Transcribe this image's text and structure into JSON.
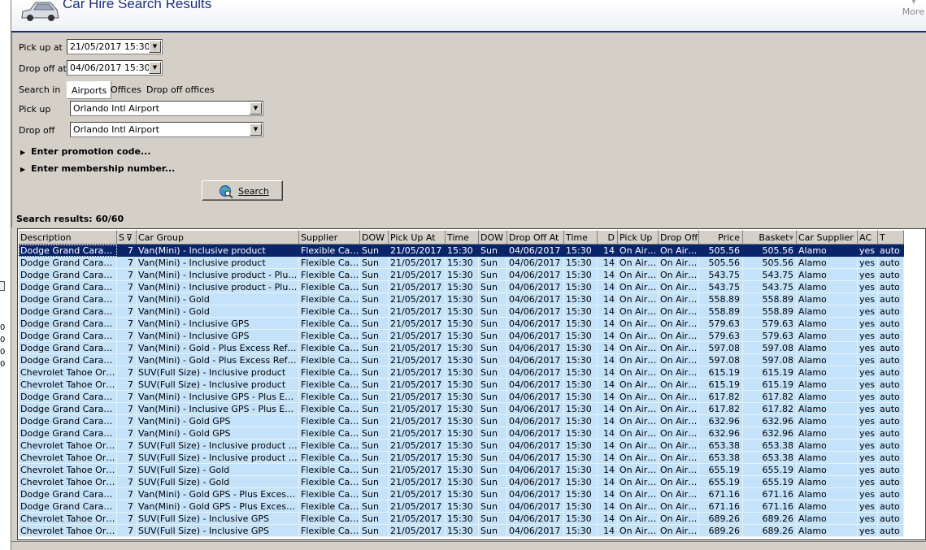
{
  "header": {
    "title": "Car Hire Search Results",
    "more_label": "More"
  },
  "left_strip": {
    "labels": [
      "0",
      "0",
      "0",
      "0"
    ]
  },
  "form": {
    "pickup_at_label": "Pick up at",
    "pickup_at_value": "21/05/2017 15:30",
    "dropoff_at_label": "Drop off at",
    "dropoff_at_value": "04/06/2017 15:30",
    "search_in_label": "Search in",
    "search_in_options": [
      "Airports",
      "Offices",
      "Drop off offices"
    ],
    "search_in_selected": "Airports",
    "pickup_label": "Pick up",
    "pickup_value": "Orlando Intl Airport",
    "dropoff_label": "Drop off",
    "dropoff_value": "Orlando Intl Airport",
    "promo_label": "Enter promotion code...",
    "membership_label": "Enter membership number...",
    "search_button": "Search",
    "results_label": "Search results: 60/60"
  },
  "grid": {
    "columns": [
      "Description",
      "S",
      "Car Group",
      "Supplier",
      "DOW",
      "Pick Up At",
      "Time",
      "DOW",
      "Drop Off At",
      "Time",
      "D",
      "Pick Up",
      "Drop Off",
      "Price",
      "Basket",
      "Car Supplier",
      "AC",
      "T"
    ],
    "rows": [
      [
        "Dodge Grand Caravan Or Similar",
        "7",
        "Van(Mini) - Inclusive product",
        "Flexible Car Hire",
        "Sun",
        "21/05/2017",
        "15:30",
        "Sun",
        "04/06/2017",
        "15:30",
        "14",
        "On Airport",
        "On Airport",
        "505.56",
        "505.56",
        "Alamo",
        "yes",
        "auto"
      ],
      [
        "Dodge Grand Caravan Or Similar",
        "7",
        "Van(Mini) - Inclusive product",
        "Flexible Car Hire",
        "Sun",
        "21/05/2017",
        "15:30",
        "Sun",
        "04/06/2017",
        "15:30",
        "14",
        "On Airport",
        "On Airport",
        "505.56",
        "505.56",
        "Alamo",
        "yes",
        "auto"
      ],
      [
        "Dodge Grand Caravan Or Similar",
        "7",
        "Van(Mini) - Inclusive product - Plus Excess Refund",
        "Flexible Car Hire",
        "Sun",
        "21/05/2017",
        "15:30",
        "Sun",
        "04/06/2017",
        "15:30",
        "14",
        "On Airport",
        "On Airport",
        "543.75",
        "543.75",
        "Alamo",
        "yes",
        "auto"
      ],
      [
        "Dodge Grand Caravan Or Similar",
        "7",
        "Van(Mini) - Inclusive product - Plus Excess Refund",
        "Flexible Car Hire",
        "Sun",
        "21/05/2017",
        "15:30",
        "Sun",
        "04/06/2017",
        "15:30",
        "14",
        "On Airport",
        "On Airport",
        "543.75",
        "543.75",
        "Alamo",
        "yes",
        "auto"
      ],
      [
        "Dodge Grand Caravan Or Similar",
        "7",
        "Van(Mini) - Gold",
        "Flexible Car Hire",
        "Sun",
        "21/05/2017",
        "15:30",
        "Sun",
        "04/06/2017",
        "15:30",
        "14",
        "On Airport",
        "On Airport",
        "558.89",
        "558.89",
        "Alamo",
        "yes",
        "auto"
      ],
      [
        "Dodge Grand Caravan Or Similar",
        "7",
        "Van(Mini) - Gold",
        "Flexible Car Hire",
        "Sun",
        "21/05/2017",
        "15:30",
        "Sun",
        "04/06/2017",
        "15:30",
        "14",
        "On Airport",
        "On Airport",
        "558.89",
        "558.89",
        "Alamo",
        "yes",
        "auto"
      ],
      [
        "Dodge Grand Caravan Or Similar",
        "7",
        "Van(Mini) - Inclusive GPS",
        "Flexible Car Hire",
        "Sun",
        "21/05/2017",
        "15:30",
        "Sun",
        "04/06/2017",
        "15:30",
        "14",
        "On Airport",
        "On Airport",
        "579.63",
        "579.63",
        "Alamo",
        "yes",
        "auto"
      ],
      [
        "Dodge Grand Caravan Or Similar",
        "7",
        "Van(Mini) - Inclusive GPS",
        "Flexible Car Hire",
        "Sun",
        "21/05/2017",
        "15:30",
        "Sun",
        "04/06/2017",
        "15:30",
        "14",
        "On Airport",
        "On Airport",
        "579.63",
        "579.63",
        "Alamo",
        "yes",
        "auto"
      ],
      [
        "Dodge Grand Caravan Or Similar",
        "7",
        "Van(Mini) - Gold - Plus Excess Refund",
        "Flexible Car Hire",
        "Sun",
        "21/05/2017",
        "15:30",
        "Sun",
        "04/06/2017",
        "15:30",
        "14",
        "On Airport",
        "On Airport",
        "597.08",
        "597.08",
        "Alamo",
        "yes",
        "auto"
      ],
      [
        "Dodge Grand Caravan Or Similar",
        "7",
        "Van(Mini) - Gold - Plus Excess Refund",
        "Flexible Car Hire",
        "Sun",
        "21/05/2017",
        "15:30",
        "Sun",
        "04/06/2017",
        "15:30",
        "14",
        "On Airport",
        "On Airport",
        "597.08",
        "597.08",
        "Alamo",
        "yes",
        "auto"
      ],
      [
        "Chevrolet Tahoe Or Similar",
        "7",
        "SUV(Full Size) - Inclusive product",
        "Flexible Car Hire",
        "Sun",
        "21/05/2017",
        "15:30",
        "Sun",
        "04/06/2017",
        "15:30",
        "14",
        "On Airport",
        "On Airport",
        "615.19",
        "615.19",
        "Alamo",
        "yes",
        "auto"
      ],
      [
        "Chevrolet Tahoe Or Similar",
        "7",
        "SUV(Full Size) - Inclusive product",
        "Flexible Car Hire",
        "Sun",
        "21/05/2017",
        "15:30",
        "Sun",
        "04/06/2017",
        "15:30",
        "14",
        "On Airport",
        "On Airport",
        "615.19",
        "615.19",
        "Alamo",
        "yes",
        "auto"
      ],
      [
        "Dodge Grand Caravan Or Similar",
        "7",
        "Van(Mini) - Inclusive GPS - Plus Excess Refund",
        "Flexible Car Hire",
        "Sun",
        "21/05/2017",
        "15:30",
        "Sun",
        "04/06/2017",
        "15:30",
        "14",
        "On Airport",
        "On Airport",
        "617.82",
        "617.82",
        "Alamo",
        "yes",
        "auto"
      ],
      [
        "Dodge Grand Caravan Or Similar",
        "7",
        "Van(Mini) - Inclusive GPS - Plus Excess Refund",
        "Flexible Car Hire",
        "Sun",
        "21/05/2017",
        "15:30",
        "Sun",
        "04/06/2017",
        "15:30",
        "14",
        "On Airport",
        "On Airport",
        "617.82",
        "617.82",
        "Alamo",
        "yes",
        "auto"
      ],
      [
        "Dodge Grand Caravan Or Similar",
        "7",
        "Van(Mini) - Gold GPS",
        "Flexible Car Hire",
        "Sun",
        "21/05/2017",
        "15:30",
        "Sun",
        "04/06/2017",
        "15:30",
        "14",
        "On Airport",
        "On Airport",
        "632.96",
        "632.96",
        "Alamo",
        "yes",
        "auto"
      ],
      [
        "Dodge Grand Caravan Or Similar",
        "7",
        "Van(Mini) - Gold GPS",
        "Flexible Car Hire",
        "Sun",
        "21/05/2017",
        "15:30",
        "Sun",
        "04/06/2017",
        "15:30",
        "14",
        "On Airport",
        "On Airport",
        "632.96",
        "632.96",
        "Alamo",
        "yes",
        "auto"
      ],
      [
        "Chevrolet Tahoe Or Similar",
        "7",
        "SUV(Full Size) - Inclusive product - Plus Excess Refund",
        "Flexible Car Hire",
        "Sun",
        "21/05/2017",
        "15:30",
        "Sun",
        "04/06/2017",
        "15:30",
        "14",
        "On Airport",
        "On Airport",
        "653.38",
        "653.38",
        "Alamo",
        "yes",
        "auto"
      ],
      [
        "Chevrolet Tahoe Or Similar",
        "7",
        "SUV(Full Size) - Inclusive product - Plus Excess Refund",
        "Flexible Car Hire",
        "Sun",
        "21/05/2017",
        "15:30",
        "Sun",
        "04/06/2017",
        "15:30",
        "14",
        "On Airport",
        "On Airport",
        "653.38",
        "653.38",
        "Alamo",
        "yes",
        "auto"
      ],
      [
        "Chevrolet Tahoe Or Similar",
        "7",
        "SUV(Full Size) - Gold",
        "Flexible Car Hire",
        "Sun",
        "21/05/2017",
        "15:30",
        "Sun",
        "04/06/2017",
        "15:30",
        "14",
        "On Airport",
        "On Airport",
        "655.19",
        "655.19",
        "Alamo",
        "yes",
        "auto"
      ],
      [
        "Chevrolet Tahoe Or Similar",
        "7",
        "SUV(Full Size) - Gold",
        "Flexible Car Hire",
        "Sun",
        "21/05/2017",
        "15:30",
        "Sun",
        "04/06/2017",
        "15:30",
        "14",
        "On Airport",
        "On Airport",
        "655.19",
        "655.19",
        "Alamo",
        "yes",
        "auto"
      ],
      [
        "Dodge Grand Caravan Or Similar",
        "7",
        "Van(Mini) - Gold GPS - Plus Excess Refund",
        "Flexible Car Hire",
        "Sun",
        "21/05/2017",
        "15:30",
        "Sun",
        "04/06/2017",
        "15:30",
        "14",
        "On Airport",
        "On Airport",
        "671.16",
        "671.16",
        "Alamo",
        "yes",
        "auto"
      ],
      [
        "Dodge Grand Caravan Or Similar",
        "7",
        "Van(Mini) - Gold GPS - Plus Excess Refund",
        "Flexible Car Hire",
        "Sun",
        "21/05/2017",
        "15:30",
        "Sun",
        "04/06/2017",
        "15:30",
        "14",
        "On Airport",
        "On Airport",
        "671.16",
        "671.16",
        "Alamo",
        "yes",
        "auto"
      ],
      [
        "Chevrolet Tahoe Or Similar",
        "7",
        "SUV(Full Size) - Inclusive GPS",
        "Flexible Car Hire",
        "Sun",
        "21/05/2017",
        "15:30",
        "Sun",
        "04/06/2017",
        "15:30",
        "14",
        "On Airport",
        "On Airport",
        "689.26",
        "689.26",
        "Alamo",
        "yes",
        "auto"
      ],
      [
        "Chevrolet Tahoe Or Similar",
        "7",
        "SUV(Full Size) - Inclusive GPS",
        "Flexible Car Hire",
        "Sun",
        "21/05/2017",
        "15:30",
        "Sun",
        "04/06/2017",
        "15:30",
        "14",
        "On Airport",
        "On Airport",
        "689.26",
        "689.26",
        "Alamo",
        "yes",
        "auto"
      ]
    ],
    "selected_row": 0
  },
  "colors": {
    "title": "#1a2e8a",
    "row_bg": "#c4e2fa",
    "selected_bg": "#0a246a",
    "chrome": "#d4d0c8"
  },
  "icons": {
    "header": "car-icon",
    "search": "globe-magnifier-icon",
    "expander": "triangle-right-icon",
    "combo": "chevron-down-icon",
    "filter": "filter-icon",
    "sort": "sort-desc-icon"
  }
}
